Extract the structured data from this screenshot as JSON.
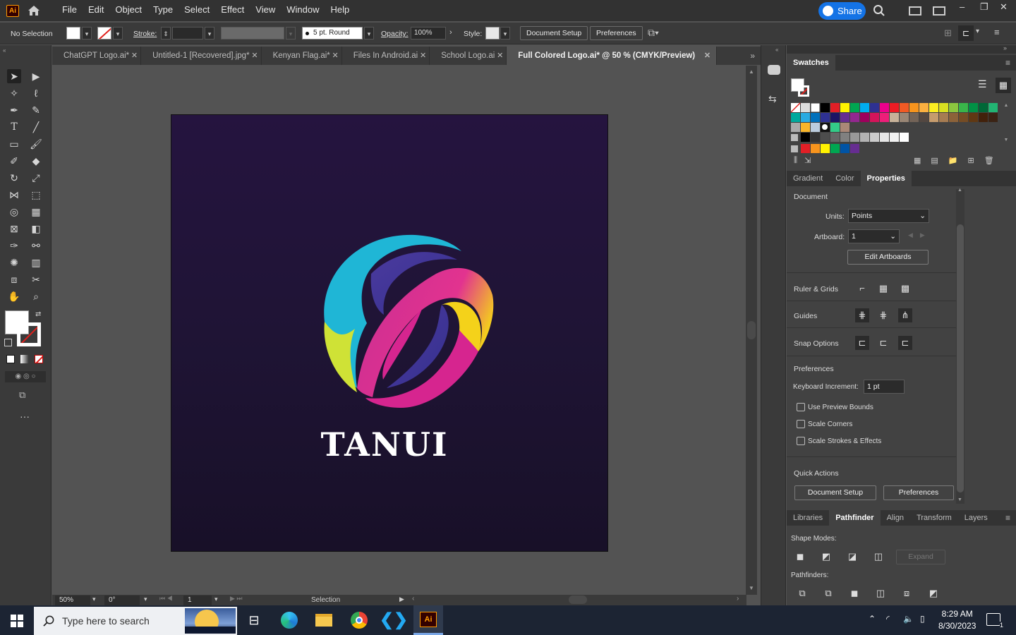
{
  "app": {
    "logo": "Ai",
    "menu": [
      "File",
      "Edit",
      "Object",
      "Type",
      "Select",
      "Effect",
      "View",
      "Window",
      "Help"
    ],
    "share": "Share"
  },
  "controlbar": {
    "selection": "No Selection",
    "stroke_label": "Stroke:",
    "brush": "5 pt. Round",
    "opacity_label": "Opacity:",
    "opacity": "100%",
    "style_label": "Style:",
    "document_setup": "Document Setup",
    "preferences": "Preferences"
  },
  "tabs": [
    {
      "label": "ChatGPT Logo.ai*"
    },
    {
      "label": "Untitled-1 [Recovered].jpg*"
    },
    {
      "label": "Kenyan Flag.ai*"
    },
    {
      "label": "Files In Android.ai"
    },
    {
      "label": "School Logo.ai"
    },
    {
      "label": "Full Colored Logo.ai* @ 50 % (CMYK/Preview)"
    }
  ],
  "artboard": {
    "text": "TANUI"
  },
  "status": {
    "zoom": "50%",
    "rotation": "0°",
    "artboard": "1",
    "tool": "Selection"
  },
  "swatches": {
    "title": "Swatches"
  },
  "panel_tabs": {
    "gradient": "Gradient",
    "color": "Color",
    "properties": "Properties"
  },
  "properties": {
    "document": "Document",
    "units_label": "Units:",
    "units": "Points",
    "artboard_label": "Artboard:",
    "artboard": "1",
    "edit_artboards": "Edit Artboards",
    "ruler_grids": "Ruler & Grids",
    "guides": "Guides",
    "snap_options": "Snap Options",
    "preferences": "Preferences",
    "keyboard_increment_label": "Keyboard Increment:",
    "keyboard_increment": "1 pt",
    "use_preview_bounds": "Use Preview Bounds",
    "scale_corners": "Scale Corners",
    "scale_strokes": "Scale Strokes & Effects",
    "quick_actions": "Quick Actions",
    "document_setup": "Document Setup",
    "preferences_btn": "Preferences"
  },
  "bottom_tabs": {
    "libraries": "Libraries",
    "pathfinder": "Pathfinder",
    "align": "Align",
    "transform": "Transform",
    "layers": "Layers"
  },
  "pathfinder": {
    "shape_modes": "Shape Modes:",
    "expand": "Expand",
    "pathfinders": "Pathfinders:"
  },
  "taskbar": {
    "search_placeholder": "Type here to search",
    "time": "8:29 AM",
    "date": "8/30/2023",
    "notifications": "1"
  },
  "colors": {
    "accent": "#1473e6",
    "artboard_top": "#25143f",
    "logo_cyan": "#1fb6d6",
    "logo_magenta": "#d6258f",
    "logo_yellow": "#f4d21a",
    "logo_purple": "#3b3a9a"
  }
}
